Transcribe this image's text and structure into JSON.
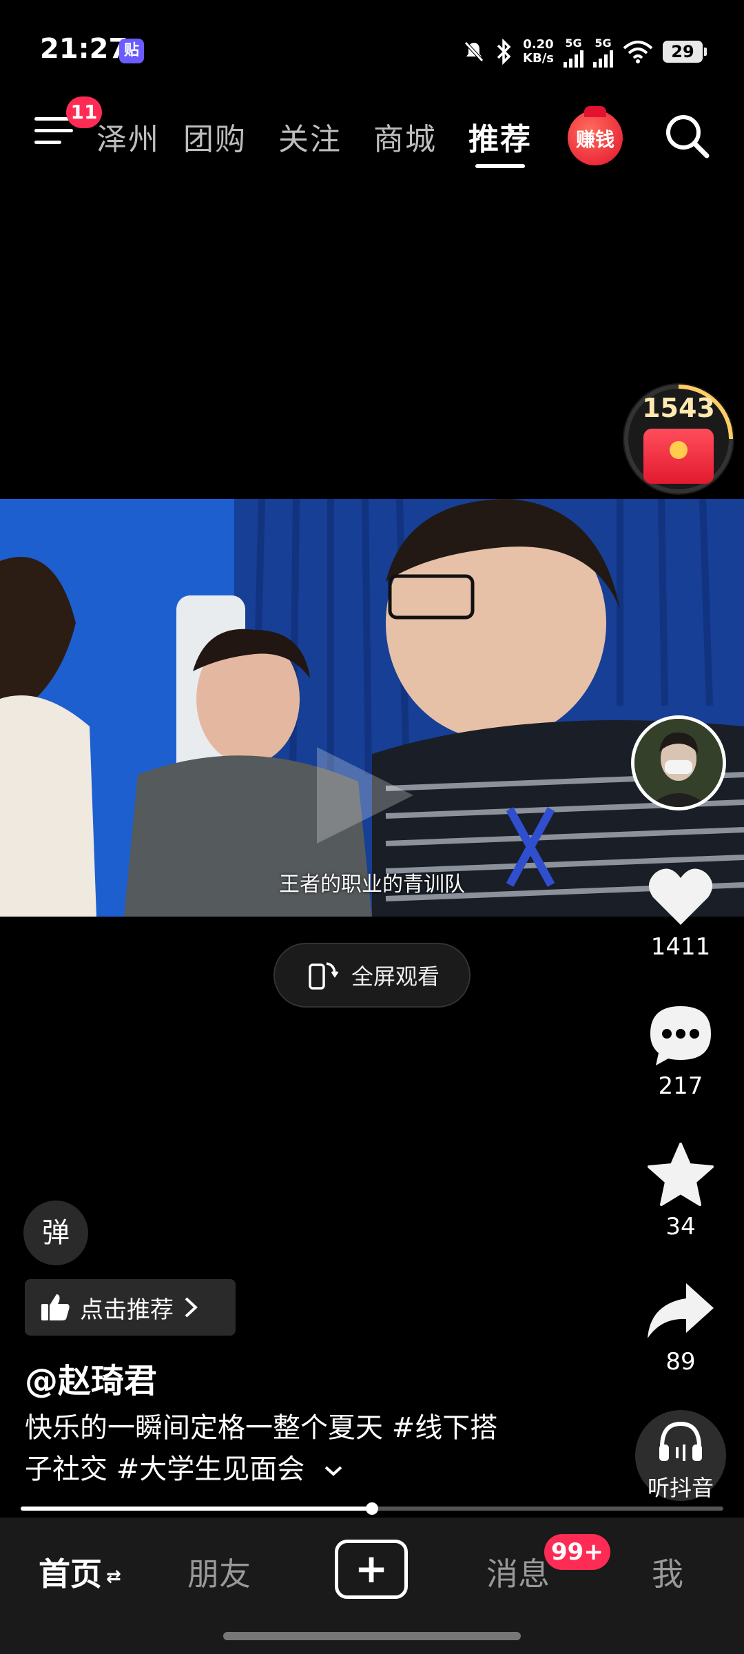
{
  "status_bar": {
    "time": "21:27",
    "app_badge": "贴",
    "net_speed_value": "0.20",
    "net_speed_unit": "KB/s",
    "sim1_label": "5G",
    "sim2_label": "5G",
    "battery": "29"
  },
  "top_nav": {
    "menu_badge": "11",
    "tabs": [
      {
        "label": "泽州",
        "active": false
      },
      {
        "label": "团购",
        "active": false
      },
      {
        "label": "关注",
        "active": false
      },
      {
        "label": "商城",
        "active": false
      },
      {
        "label": "推荐",
        "active": true
      }
    ],
    "earn_label": "赚钱"
  },
  "coin_widget": {
    "count": "1543",
    "progress": 0.25
  },
  "video": {
    "subtitle": "王者的职业的青训队"
  },
  "fullscreen_label": "全屏观看",
  "actions": {
    "likes": "1411",
    "comments": "217",
    "favorites": "34",
    "shares": "89",
    "listen_label": "听抖音"
  },
  "post": {
    "danmu_label": "弹",
    "recommend_label": "点击推荐",
    "username": "@赵琦君",
    "caption_line1": "快乐的一瞬间定格一整个夏天 #线下搭",
    "caption_line2": "子社交 #大学生见面会",
    "progress": 0.5
  },
  "bottom_nav": {
    "home": "首页",
    "friends": "朋友",
    "messages": "消息",
    "messages_badge": "99+",
    "me": "我"
  },
  "colors": {
    "accent": "#fe2c55",
    "coin_text": "#ffe9b0",
    "video_bg": "#1f52b8"
  }
}
